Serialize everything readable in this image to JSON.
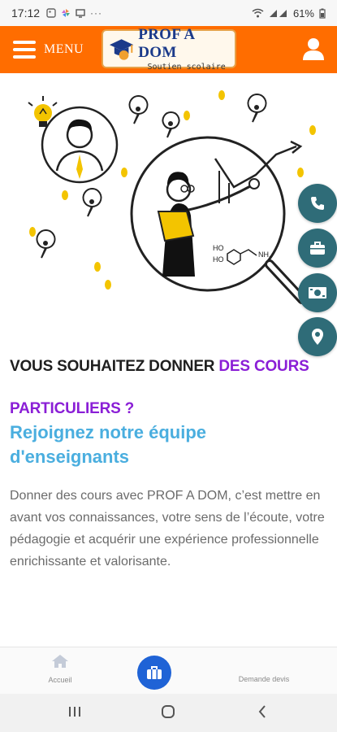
{
  "status_bar": {
    "time": "17:12",
    "battery": "61%"
  },
  "header": {
    "menu_label": "MENU",
    "logo_brand": "PROF A DOM",
    "logo_tagline": "Soutien scolaire"
  },
  "hero": {
    "title_part1": "VOUS SOUHAITEZ DONNER ",
    "title_accent1": "DES COURS",
    "title_accent2": "PARTICULIERS ?",
    "subtitle": "Rejoignez notre équipe d'enseignants",
    "paragraph": "Donner des cours avec PROF A DOM, c’est mettre en avant vos connaissances, votre sens de l’écoute, votre pédagogie et acquérir une expérience professionnelle enrichissante et valorisante."
  },
  "illustration": {
    "formula_ho1": "HO",
    "formula_ho2": "HO",
    "formula_nh": "NH."
  },
  "fabs": [
    "phone-icon",
    "briefcase-icon",
    "money-icon",
    "location-icon"
  ],
  "bottom_nav": {
    "home_label": "Accueil",
    "devis_label": "Demande devis"
  },
  "colors": {
    "header": "#ff6d00",
    "accent_purple": "#8a1ed6",
    "subtitle_blue": "#4aaedf",
    "fab": "#2f6c78",
    "nav_center": "#1f63d6"
  }
}
